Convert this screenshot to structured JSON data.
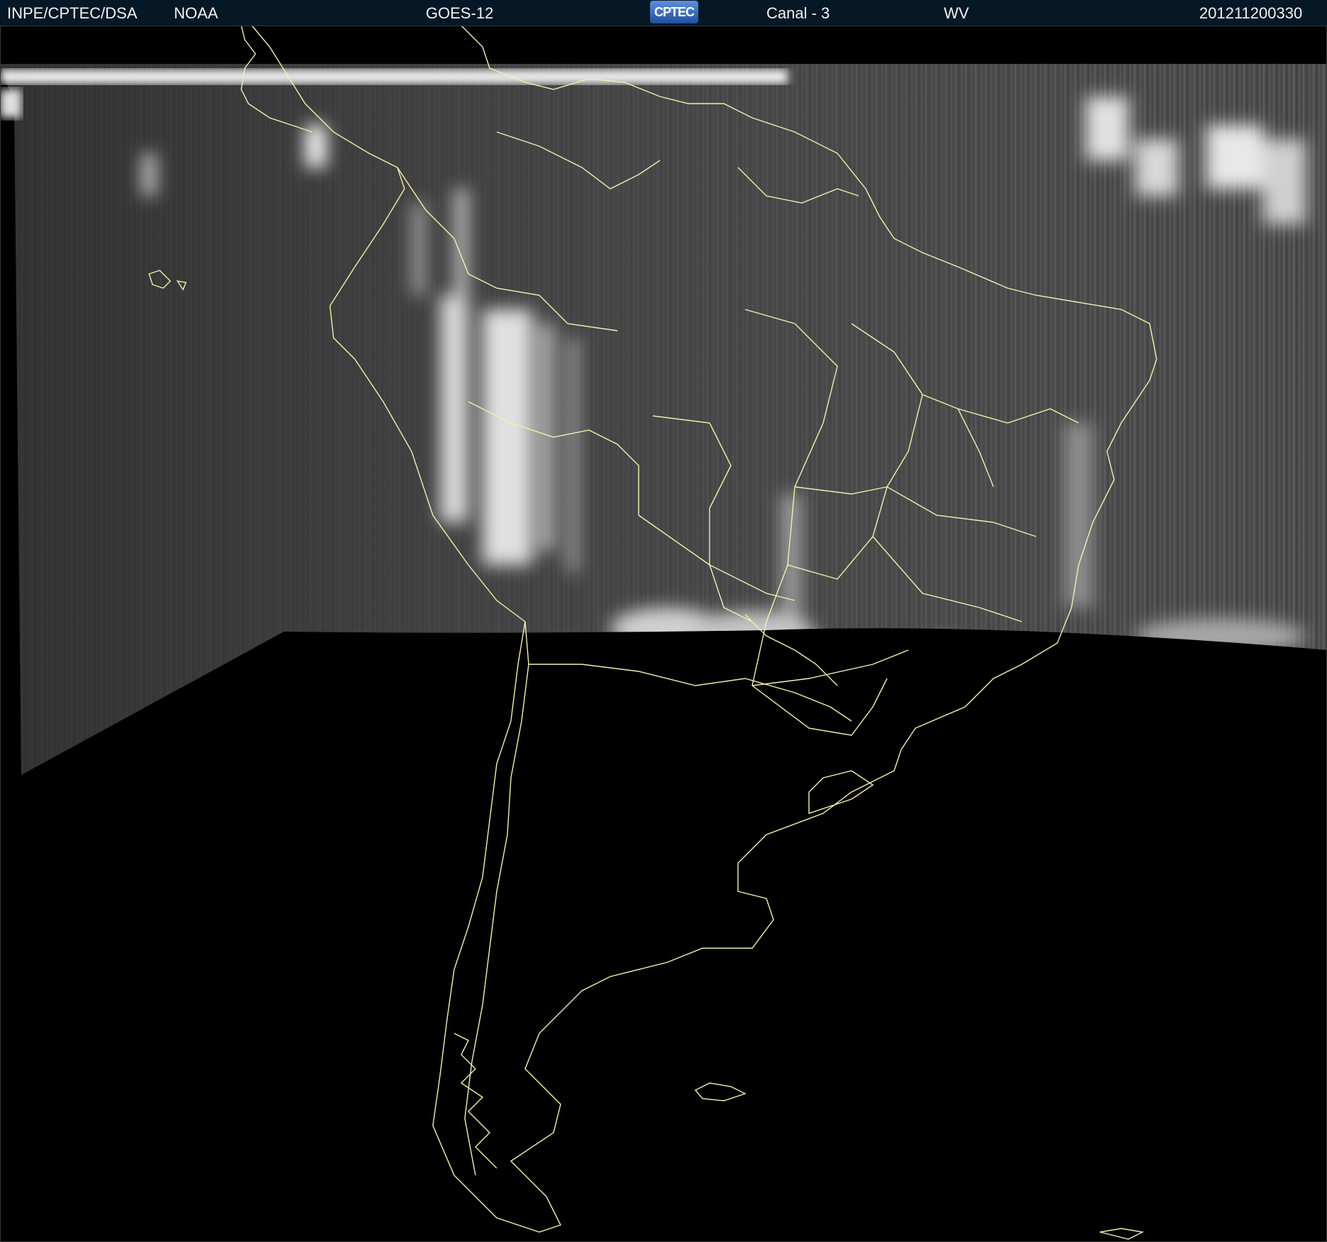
{
  "header": {
    "institution": "INPE/CPTEC/DSA",
    "agency": "NOAA",
    "satellite": "GOES-12",
    "logo_text": "CPTEC",
    "channel": "Canal - 3",
    "band": "WV",
    "timestamp": "201211200330"
  },
  "colors": {
    "header_bg": "#061826",
    "header_text": "#f2f2f2",
    "coastline": "#f4f0b0",
    "background": "#000000",
    "imagery": "#555555"
  }
}
